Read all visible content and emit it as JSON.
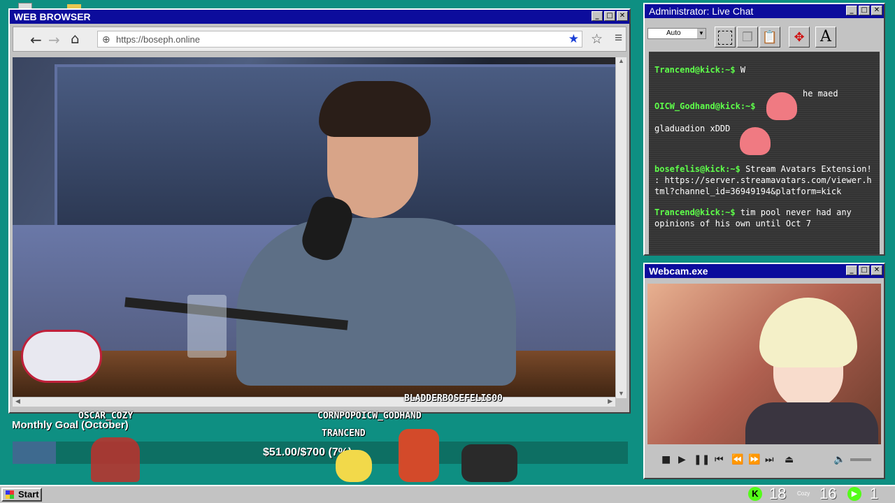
{
  "browser": {
    "title": "WEB BROWSER",
    "url": "https://boseph.online"
  },
  "chat": {
    "title": "Administrator: Live Chat",
    "dropdown_value": "Auto",
    "messages": [
      {
        "user": "Trancend@kick:~$",
        "text": "W"
      },
      {
        "user": "",
        "text": "he maed"
      },
      {
        "user": "OICW_Godhand@kick:~$",
        "text": ""
      },
      {
        "user": "",
        "text": "gladuadion xDDD"
      },
      {
        "user": "bosefelis@kick:~$",
        "text": "Stream Avatars Extension! : https://server.streamavatars.com/viewer.html?channel_id=36949194&platform=kick"
      },
      {
        "user": "Trancend@kick:~$",
        "text": "tim pool never had any opinions of his own until Oct 7"
      }
    ]
  },
  "webcam": {
    "title": "Webcam.exe"
  },
  "goal": {
    "title": "Monthly Goal (October)",
    "amount": "$51.00/$700",
    "percent_suffix": "(7%)",
    "progress": 0.07
  },
  "avatars": [
    "OSCAR_COZY",
    "CORNPOPOICW_GODHAND",
    "TRANCEND",
    "BLADDERBOSEFELIS00"
  ],
  "taskbar": {
    "start_label": "Start",
    "counter_a": "18",
    "counter_b": "16",
    "counter_c": "1",
    "cozy_label": "Cozy"
  },
  "colors": {
    "desktop": "#0e8f82",
    "titlebar": "#0c0c9c",
    "chat_user": "#5eff4a",
    "kick_green": "#53fc18"
  }
}
